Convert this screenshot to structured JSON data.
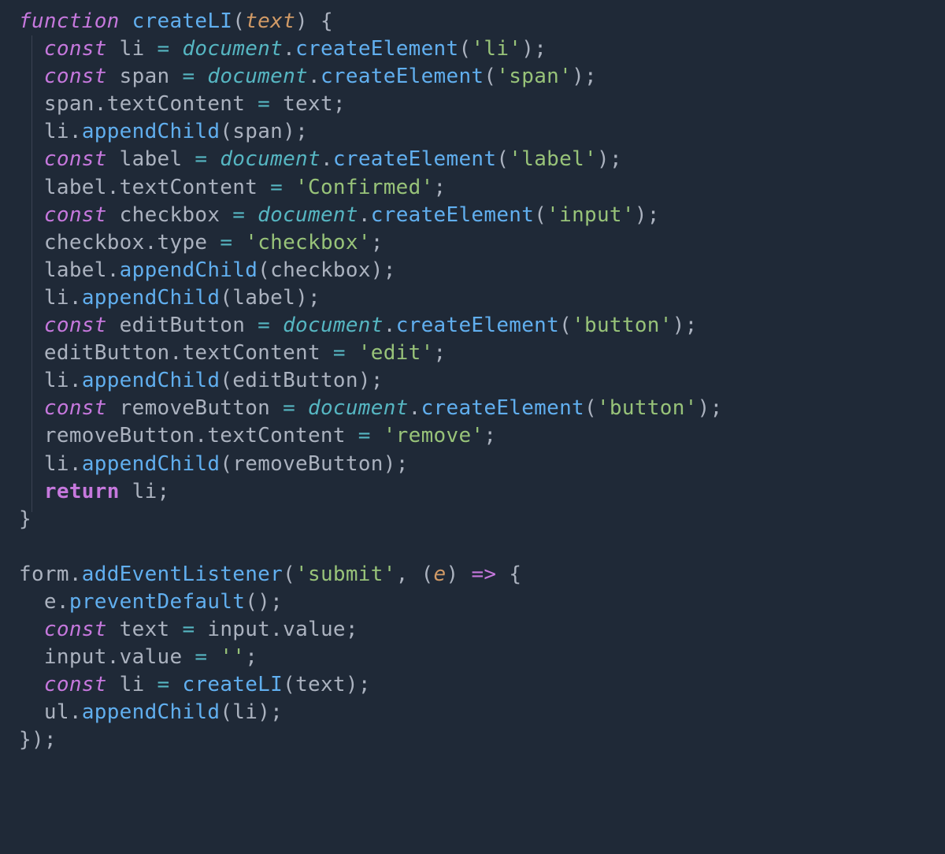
{
  "code": {
    "lines": [
      {
        "indent": 0,
        "tokens": [
          {
            "t": "function ",
            "c": "kw-italic"
          },
          {
            "t": "createLI",
            "c": "fn"
          },
          {
            "t": "(",
            "c": "punc"
          },
          {
            "t": "text",
            "c": "param"
          },
          {
            "t": ") {",
            "c": "punc"
          }
        ]
      },
      {
        "indent": 1,
        "tokens": [
          {
            "t": "const ",
            "c": "kw-italic"
          },
          {
            "t": "li ",
            "c": "var"
          },
          {
            "t": "= ",
            "c": "op"
          },
          {
            "t": "document",
            "c": "obj"
          },
          {
            "t": ".",
            "c": "punc"
          },
          {
            "t": "createElement",
            "c": "fn"
          },
          {
            "t": "(",
            "c": "punc"
          },
          {
            "t": "'li'",
            "c": "str"
          },
          {
            "t": ");",
            "c": "punc"
          }
        ]
      },
      {
        "indent": 1,
        "tokens": [
          {
            "t": "const ",
            "c": "kw-italic"
          },
          {
            "t": "span ",
            "c": "var"
          },
          {
            "t": "= ",
            "c": "op"
          },
          {
            "t": "document",
            "c": "obj"
          },
          {
            "t": ".",
            "c": "punc"
          },
          {
            "t": "createElement",
            "c": "fn"
          },
          {
            "t": "(",
            "c": "punc"
          },
          {
            "t": "'span'",
            "c": "str"
          },
          {
            "t": ");",
            "c": "punc"
          }
        ]
      },
      {
        "indent": 1,
        "tokens": [
          {
            "t": "span",
            "c": "var"
          },
          {
            "t": ".",
            "c": "punc"
          },
          {
            "t": "textContent ",
            "c": "prop"
          },
          {
            "t": "= ",
            "c": "op"
          },
          {
            "t": "text",
            "c": "var"
          },
          {
            "t": ";",
            "c": "punc"
          }
        ]
      },
      {
        "indent": 1,
        "tokens": [
          {
            "t": "li",
            "c": "var"
          },
          {
            "t": ".",
            "c": "punc"
          },
          {
            "t": "appendChild",
            "c": "fn"
          },
          {
            "t": "(",
            "c": "punc"
          },
          {
            "t": "span",
            "c": "var"
          },
          {
            "t": ");",
            "c": "punc"
          }
        ]
      },
      {
        "indent": 1,
        "tokens": [
          {
            "t": "const ",
            "c": "kw-italic"
          },
          {
            "t": "label ",
            "c": "var"
          },
          {
            "t": "= ",
            "c": "op"
          },
          {
            "t": "document",
            "c": "obj"
          },
          {
            "t": ".",
            "c": "punc"
          },
          {
            "t": "createElement",
            "c": "fn"
          },
          {
            "t": "(",
            "c": "punc"
          },
          {
            "t": "'label'",
            "c": "str"
          },
          {
            "t": ");",
            "c": "punc"
          }
        ]
      },
      {
        "indent": 1,
        "tokens": [
          {
            "t": "label",
            "c": "var"
          },
          {
            "t": ".",
            "c": "punc"
          },
          {
            "t": "textContent ",
            "c": "prop"
          },
          {
            "t": "= ",
            "c": "op"
          },
          {
            "t": "'Confirmed'",
            "c": "str"
          },
          {
            "t": ";",
            "c": "punc"
          }
        ]
      },
      {
        "indent": 1,
        "tokens": [
          {
            "t": "const ",
            "c": "kw-italic"
          },
          {
            "t": "checkbox ",
            "c": "var"
          },
          {
            "t": "= ",
            "c": "op"
          },
          {
            "t": "document",
            "c": "obj"
          },
          {
            "t": ".",
            "c": "punc"
          },
          {
            "t": "createElement",
            "c": "fn"
          },
          {
            "t": "(",
            "c": "punc"
          },
          {
            "t": "'input'",
            "c": "str"
          },
          {
            "t": ");",
            "c": "punc"
          }
        ]
      },
      {
        "indent": 1,
        "tokens": [
          {
            "t": "checkbox",
            "c": "var"
          },
          {
            "t": ".",
            "c": "punc"
          },
          {
            "t": "type ",
            "c": "prop"
          },
          {
            "t": "= ",
            "c": "op"
          },
          {
            "t": "'checkbox'",
            "c": "str"
          },
          {
            "t": ";",
            "c": "punc"
          }
        ]
      },
      {
        "indent": 1,
        "tokens": [
          {
            "t": "label",
            "c": "var"
          },
          {
            "t": ".",
            "c": "punc"
          },
          {
            "t": "appendChild",
            "c": "fn"
          },
          {
            "t": "(",
            "c": "punc"
          },
          {
            "t": "checkbox",
            "c": "var"
          },
          {
            "t": ");",
            "c": "punc"
          }
        ]
      },
      {
        "indent": 1,
        "tokens": [
          {
            "t": "li",
            "c": "var"
          },
          {
            "t": ".",
            "c": "punc"
          },
          {
            "t": "appendChild",
            "c": "fn"
          },
          {
            "t": "(",
            "c": "punc"
          },
          {
            "t": "label",
            "c": "var"
          },
          {
            "t": ");",
            "c": "punc"
          }
        ]
      },
      {
        "indent": 1,
        "tokens": [
          {
            "t": "const ",
            "c": "kw-italic"
          },
          {
            "t": "editButton ",
            "c": "var"
          },
          {
            "t": "= ",
            "c": "op"
          },
          {
            "t": "document",
            "c": "obj"
          },
          {
            "t": ".",
            "c": "punc"
          },
          {
            "t": "createElement",
            "c": "fn"
          },
          {
            "t": "(",
            "c": "punc"
          },
          {
            "t": "'button'",
            "c": "str"
          },
          {
            "t": ");",
            "c": "punc"
          }
        ]
      },
      {
        "indent": 1,
        "tokens": [
          {
            "t": "editButton",
            "c": "var"
          },
          {
            "t": ".",
            "c": "punc"
          },
          {
            "t": "textContent ",
            "c": "prop"
          },
          {
            "t": "= ",
            "c": "op"
          },
          {
            "t": "'edit'",
            "c": "str"
          },
          {
            "t": ";",
            "c": "punc"
          }
        ]
      },
      {
        "indent": 1,
        "tokens": [
          {
            "t": "li",
            "c": "var"
          },
          {
            "t": ".",
            "c": "punc"
          },
          {
            "t": "appendChild",
            "c": "fn"
          },
          {
            "t": "(",
            "c": "punc"
          },
          {
            "t": "editButton",
            "c": "var"
          },
          {
            "t": ");",
            "c": "punc"
          }
        ]
      },
      {
        "indent": 1,
        "tokens": [
          {
            "t": "const ",
            "c": "kw-italic"
          },
          {
            "t": "removeButton ",
            "c": "var"
          },
          {
            "t": "= ",
            "c": "op"
          },
          {
            "t": "document",
            "c": "obj"
          },
          {
            "t": ".",
            "c": "punc"
          },
          {
            "t": "createElement",
            "c": "fn"
          },
          {
            "t": "(",
            "c": "punc"
          },
          {
            "t": "'button'",
            "c": "str"
          },
          {
            "t": ");",
            "c": "punc"
          }
        ]
      },
      {
        "indent": 1,
        "tokens": [
          {
            "t": "removeButton",
            "c": "var"
          },
          {
            "t": ".",
            "c": "punc"
          },
          {
            "t": "textContent ",
            "c": "prop"
          },
          {
            "t": "= ",
            "c": "op"
          },
          {
            "t": "'remove'",
            "c": "str"
          },
          {
            "t": ";",
            "c": "punc"
          }
        ]
      },
      {
        "indent": 1,
        "tokens": [
          {
            "t": "li",
            "c": "var"
          },
          {
            "t": ".",
            "c": "punc"
          },
          {
            "t": "appendChild",
            "c": "fn"
          },
          {
            "t": "(",
            "c": "punc"
          },
          {
            "t": "removeButton",
            "c": "var"
          },
          {
            "t": ");",
            "c": "punc"
          }
        ]
      },
      {
        "indent": 1,
        "tokens": [
          {
            "t": "return ",
            "c": "kw bold"
          },
          {
            "t": "li",
            "c": "var"
          },
          {
            "t": ";",
            "c": "punc"
          }
        ]
      },
      {
        "indent": 0,
        "tokens": [
          {
            "t": "}",
            "c": "punc"
          }
        ]
      },
      {
        "indent": 0,
        "tokens": []
      },
      {
        "indent": 0,
        "tokens": [
          {
            "t": "form",
            "c": "var"
          },
          {
            "t": ".",
            "c": "punc"
          },
          {
            "t": "addEventListener",
            "c": "fn"
          },
          {
            "t": "(",
            "c": "punc"
          },
          {
            "t": "'submit'",
            "c": "str"
          },
          {
            "t": ", (",
            "c": "punc"
          },
          {
            "t": "e",
            "c": "param"
          },
          {
            "t": ") ",
            "c": "punc"
          },
          {
            "t": "=> ",
            "c": "kw"
          },
          {
            "t": "{",
            "c": "punc"
          }
        ]
      },
      {
        "indent": 1,
        "tokens": [
          {
            "t": "e",
            "c": "var"
          },
          {
            "t": ".",
            "c": "punc"
          },
          {
            "t": "preventDefault",
            "c": "fn"
          },
          {
            "t": "();",
            "c": "punc"
          }
        ]
      },
      {
        "indent": 1,
        "tokens": [
          {
            "t": "const ",
            "c": "kw-italic"
          },
          {
            "t": "text ",
            "c": "var"
          },
          {
            "t": "= ",
            "c": "op"
          },
          {
            "t": "input",
            "c": "var"
          },
          {
            "t": ".",
            "c": "punc"
          },
          {
            "t": "value",
            "c": "prop"
          },
          {
            "t": ";",
            "c": "punc"
          }
        ]
      },
      {
        "indent": 1,
        "tokens": [
          {
            "t": "input",
            "c": "var"
          },
          {
            "t": ".",
            "c": "punc"
          },
          {
            "t": "value ",
            "c": "prop"
          },
          {
            "t": "= ",
            "c": "op"
          },
          {
            "t": "''",
            "c": "str"
          },
          {
            "t": ";",
            "c": "punc"
          }
        ]
      },
      {
        "indent": 1,
        "tokens": [
          {
            "t": "const ",
            "c": "kw-italic"
          },
          {
            "t": "li ",
            "c": "var"
          },
          {
            "t": "= ",
            "c": "op"
          },
          {
            "t": "createLI",
            "c": "fn"
          },
          {
            "t": "(",
            "c": "punc"
          },
          {
            "t": "text",
            "c": "var"
          },
          {
            "t": ");",
            "c": "punc"
          }
        ]
      },
      {
        "indent": 1,
        "tokens": [
          {
            "t": "ul",
            "c": "var"
          },
          {
            "t": ".",
            "c": "punc"
          },
          {
            "t": "appendChild",
            "c": "fn"
          },
          {
            "t": "(",
            "c": "punc"
          },
          {
            "t": "li",
            "c": "var"
          },
          {
            "t": ");",
            "c": "punc"
          }
        ]
      },
      {
        "indent": 0,
        "tokens": [
          {
            "t": "});",
            "c": "punc"
          }
        ]
      }
    ]
  }
}
